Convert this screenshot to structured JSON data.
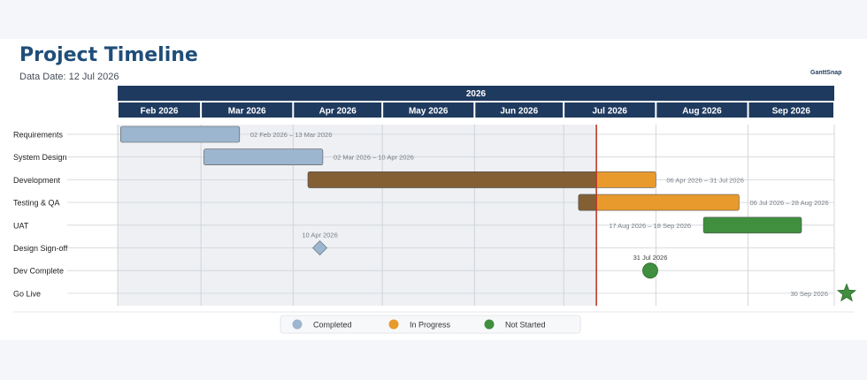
{
  "header": {
    "title": "Project Timeline",
    "data_date_label": "Data Date: 12 Jul 2026",
    "brand": "GanttSnap"
  },
  "colors": {
    "completed": "#9cb6cf",
    "in_progress": "#e99a2c",
    "not_started": "#3f8f3e",
    "elapsed_in_progress": "#845f34",
    "header_bg": "#1f3a5f",
    "today_line": "#c0392b"
  },
  "chart_data": {
    "type": "gantt",
    "year_label": "2026",
    "months": [
      "Feb 2026",
      "Mar 2026",
      "Apr 2026",
      "May 2026",
      "Jun 2026",
      "Jul 2026",
      "Aug 2026",
      "Sep 2026"
    ],
    "x_range": [
      "2026-02-01",
      "2026-09-30"
    ],
    "data_date": "2026-07-12",
    "tasks": [
      {
        "name": "Requirements",
        "start": "2026-02-02",
        "end": "2026-03-13",
        "status": "completed",
        "label": "02 Feb 2026 – 13 Mar 2026"
      },
      {
        "name": "System Design",
        "start": "2026-03-02",
        "end": "2026-04-10",
        "status": "completed",
        "label": "02 Mar 2026 – 10 Apr 2026"
      },
      {
        "name": "Development",
        "start": "2026-04-06",
        "end": "2026-07-31",
        "status": "in_progress",
        "label": "06 Apr 2026 – 31 Jul 2026"
      },
      {
        "name": "Testing & QA",
        "start": "2026-07-06",
        "end": "2026-08-28",
        "status": "in_progress",
        "label": "06 Jul 2026 – 28 Aug 2026"
      },
      {
        "name": "UAT",
        "start": "2026-08-17",
        "end": "2026-09-18",
        "status": "not_started",
        "label": "17 Aug 2026 – 18 Sep 2026"
      }
    ],
    "milestones": [
      {
        "name": "Design Sign-off",
        "date": "2026-04-10",
        "shape": "diamond",
        "status": "completed",
        "label": "10 Apr 2026"
      },
      {
        "name": "Dev Complete",
        "date": "2026-07-31",
        "shape": "circle",
        "status": "not_started",
        "label": "31 Jul 2026"
      },
      {
        "name": "Go Live",
        "date": "2026-09-30",
        "shape": "star",
        "status": "not_started",
        "label": "30 Sep 2026"
      }
    ],
    "legend": [
      {
        "label": "Completed",
        "status": "completed"
      },
      {
        "label": "In Progress",
        "status": "in_progress"
      },
      {
        "label": "Not Started",
        "status": "not_started"
      }
    ],
    "legend_position": "bottom"
  }
}
